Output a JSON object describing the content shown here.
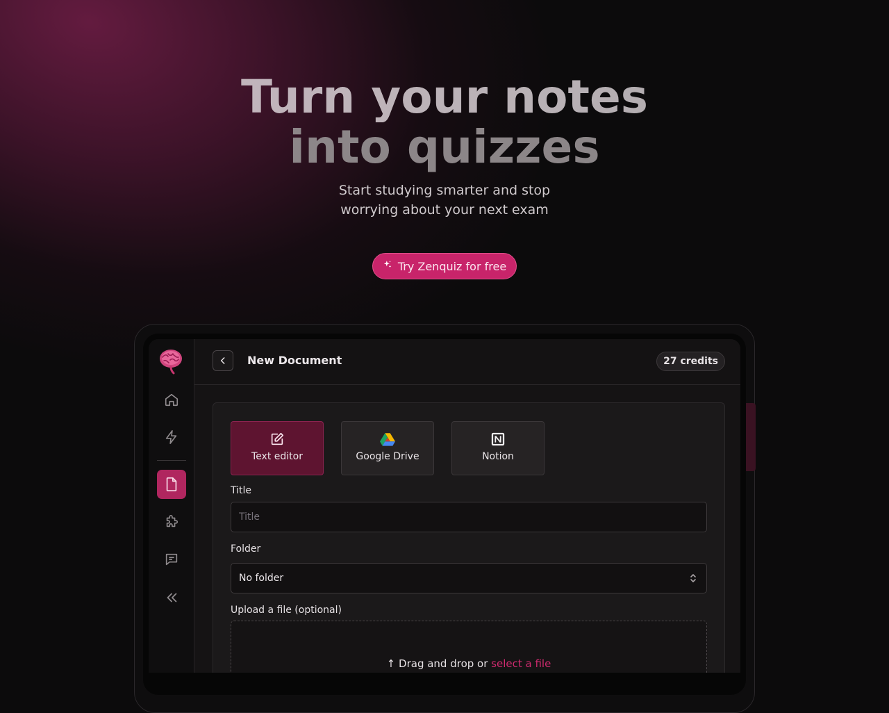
{
  "hero": {
    "title_line1": "Turn your notes",
    "title_line2": "into quizzes",
    "subtitle_line1": "Start studying smarter and stop",
    "subtitle_line2": "worrying about your next exam",
    "cta_label": "Try Zenquiz for free"
  },
  "app": {
    "page_title": "New Document",
    "credits": "27 credits",
    "sidebar": {
      "items": [
        "home-icon",
        "lightning-icon",
        "document-icon",
        "puzzle-icon",
        "chat-icon",
        "collapse-icon"
      ],
      "active": "document-icon"
    },
    "sources": [
      {
        "label": "Text editor",
        "icon": "edit-icon",
        "active": true
      },
      {
        "label": "Google Drive",
        "icon": "google-drive-icon",
        "active": false
      },
      {
        "label": "Notion",
        "icon": "notion-icon",
        "active": false
      }
    ],
    "form": {
      "title_label": "Title",
      "title_placeholder": "Title",
      "folder_label": "Folder",
      "folder_value": "No folder",
      "upload_label": "Upload a file (optional)",
      "dropzone_text": "Drag and drop or",
      "dropzone_link": "select a file"
    }
  },
  "colors": {
    "accent": "#c8246a",
    "active_source_bg": "#5e1430",
    "background": "#0c0b0c"
  }
}
